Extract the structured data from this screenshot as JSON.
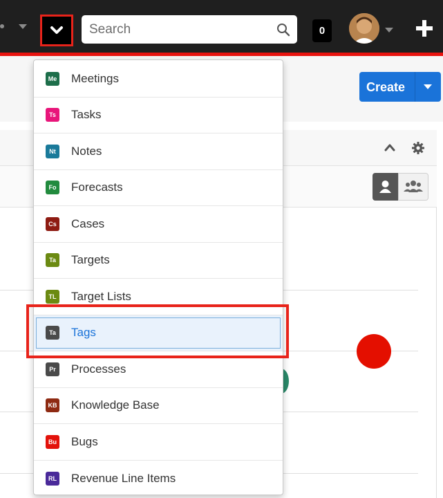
{
  "search": {
    "placeholder": "Search"
  },
  "notifications": {
    "count": "0"
  },
  "create_button": {
    "label": "Create"
  },
  "modules_menu": {
    "items": [
      {
        "abbr": "Me",
        "label": "Meetings",
        "color": "#1d6e4a"
      },
      {
        "abbr": "Ts",
        "label": "Tasks",
        "color": "#e8157a"
      },
      {
        "abbr": "Nt",
        "label": "Notes",
        "color": "#1a7a9a"
      },
      {
        "abbr": "Fo",
        "label": "Forecasts",
        "color": "#228b3e"
      },
      {
        "abbr": "Cs",
        "label": "Cases",
        "color": "#8e1b12"
      },
      {
        "abbr": "Ta",
        "label": "Targets",
        "color": "#6b8a12"
      },
      {
        "abbr": "TL",
        "label": "Target Lists",
        "color": "#6b8a12"
      },
      {
        "abbr": "Ta",
        "label": "Tags",
        "color": "#4a4a4a",
        "active": true
      },
      {
        "abbr": "Pr",
        "label": "Processes",
        "color": "#4a4a4a"
      },
      {
        "abbr": "KB",
        "label": "Knowledge Base",
        "color": "#8e2a12"
      },
      {
        "abbr": "Bu",
        "label": "Bugs",
        "color": "#e3120b"
      },
      {
        "abbr": "RL",
        "label": "Revenue Line Items",
        "color": "#4a2a9a"
      }
    ]
  },
  "colors": {
    "navbar": "#1f1f1f",
    "accent_red": "#e8231a",
    "primary_blue": "#1a73d9"
  }
}
